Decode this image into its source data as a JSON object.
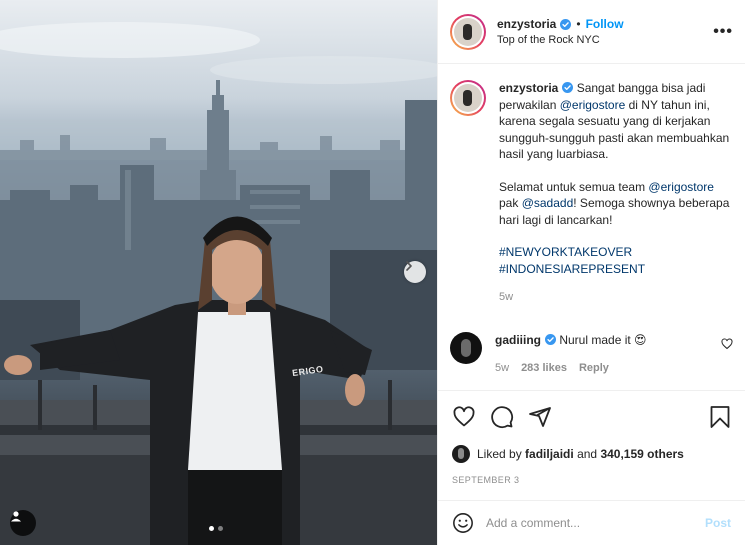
{
  "post": {
    "username": "enzystoria",
    "follow_label": "Follow",
    "separator": "•",
    "location": "Top of the Rock NYC",
    "more_label": "•••",
    "shirt_text": "ERIGO"
  },
  "caption": {
    "username": "enzystoria",
    "text_1": "Sangat bangga bisa jadi perwakilan",
    "mention_1": "@erigostore",
    "text_2": "di NY tahun ini, karena segala sesuatu yang di kerjakan sungguh-sungguh pasti akan membuahkan hasil yang luarbiasa.",
    "text_3": "Selamat untuk semua team",
    "mention_2": "@erigostore",
    "text_4": "pak",
    "mention_3": "@sadadd",
    "text_5": "! Semoga shownya beberapa hari lagi di lancarkan!",
    "hashtag_1": "#NEWYORKTAKEOVER",
    "hashtag_2": "#INDONESIAREPRESENT",
    "age": "5w"
  },
  "comment": {
    "username": "gadiiing",
    "text": "Nurul made it 😍",
    "age": "5w",
    "likes": "283 likes",
    "reply_label": "Reply"
  },
  "likes": {
    "prefix": "Liked by",
    "user": "fadiljaidi",
    "and": "and",
    "others": "340,159 others"
  },
  "date": "SEPTEMBER 3",
  "add_comment": {
    "placeholder": "Add a comment...",
    "post_label": "Post"
  },
  "carousel": {
    "total": 2,
    "active": 1
  },
  "colors": {
    "link": "#0095f6",
    "mention": "#00376b",
    "muted": "#8e8e8e",
    "post_disabled": "#b2dffc"
  },
  "icons": [
    "verified-badge-icon",
    "more-options-icon",
    "heart-icon",
    "comment-icon",
    "share-icon",
    "bookmark-icon",
    "emoji-icon",
    "chevron-right-icon",
    "user-tag-icon"
  ]
}
